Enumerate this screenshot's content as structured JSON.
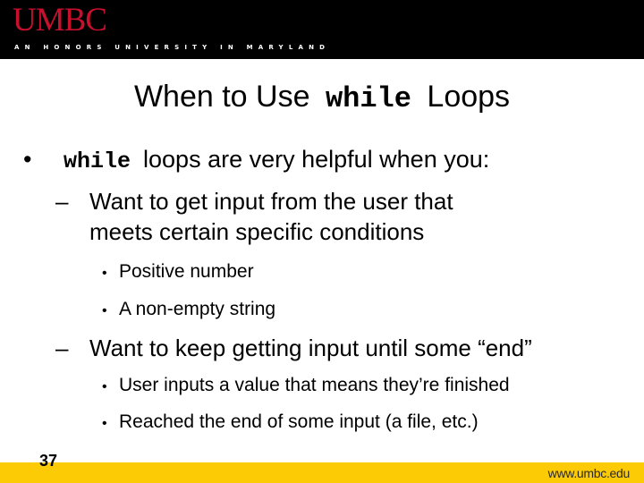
{
  "header": {
    "logo_text": "UMBC",
    "tagline": "AN HONORS UNIVERSITY IN MARYLAND",
    "logo_color": "#c8102e",
    "background": "#000000"
  },
  "slide": {
    "title": {
      "prefix": "When to Use",
      "code": "while",
      "suffix": "Loops"
    },
    "bullets": [
      {
        "marker": "•",
        "code": "while",
        "text": "loops are very helpful when you:",
        "subitems": [
          {
            "marker": "–",
            "text_line1": "Want to get input from the user that",
            "text_line2": "meets certain specific conditions",
            "subitems": [
              {
                "marker": "•",
                "text": "Positive number"
              },
              {
                "marker": "•",
                "text": "A non-empty string"
              }
            ]
          },
          {
            "marker": "–",
            "text_line1": "Want to keep getting input until some “end”",
            "subitems": [
              {
                "marker": "•",
                "text": "User inputs a value that means they’re finished"
              },
              {
                "marker": "•",
                "text": "Reached the end of some input (a file, etc.)"
              }
            ]
          }
        ]
      }
    ]
  },
  "footer": {
    "page_number": "37",
    "url": "www.umbc.edu",
    "band_color": "#fdcb06"
  }
}
